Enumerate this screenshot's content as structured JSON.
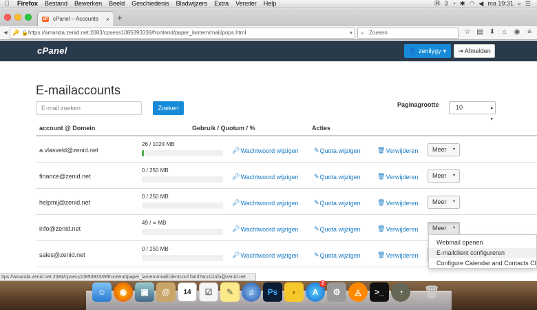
{
  "menubar": {
    "apple": "",
    "items": [
      "Firefox",
      "Bestand",
      "Bewerken",
      "Beeld",
      "Geschiedenis",
      "Bladwijzers",
      "Extra",
      "Venster",
      "Help"
    ],
    "status_num": "3",
    "clock": "ma 19:31"
  },
  "browser": {
    "tab_title": "cPanel – Accounts",
    "tab_favicon": "cP",
    "new_tab": "+",
    "url": "https://amanda.zenid.net:2083/cpsess1085393339/frontend/paper_lantern/mail/pops.html",
    "search_placeholder": "Zoeken",
    "status_url": "ttps://amanda.zenid.net:2083/cpsess1085393339/frontend/paper_lantern/mail/clientconf.html?acct=info@zenid.net"
  },
  "header": {
    "logo": "cPanel",
    "user": "zenilygy",
    "logout": "Afmelden"
  },
  "page": {
    "title": "E-mailaccounts",
    "search_placeholder": "E-mail zoeken",
    "search_button": "Zoeken",
    "page_size_label": "Paginagrootte",
    "page_size_value": "10"
  },
  "table": {
    "headers": {
      "account": "account @ Domein",
      "usage": "Gebruik / Quotum / %",
      "actions": "Acties"
    },
    "rows": [
      {
        "email": "a.vlasveld@zenid.net",
        "usage": "26 / 1024 MB",
        "percent": 2.5
      },
      {
        "email": "finance@zenid.net",
        "usage": "0 / 250 MB",
        "percent": 0
      },
      {
        "email": "helpmij@zenid.net",
        "usage": "0 / 250 MB",
        "percent": 0
      },
      {
        "email": "info@zenid.net",
        "usage": "49 / ∞ MB",
        "percent": 0
      },
      {
        "email": "sales@zenid.net",
        "usage": "0 / 250 MB",
        "percent": 0
      }
    ],
    "action_password": "Wachtwoord wijzigen",
    "action_quota": "Quota wijzigen",
    "action_delete": "Verwijderen",
    "action_more": "Meer"
  },
  "dropdown": {
    "items": [
      "Webmail openen",
      "E-mailclient configureren",
      "Configure Calendar and Contacts Client"
    ]
  },
  "colors": {
    "header_bg": "#293a4a",
    "primary": "#178bd8",
    "link": "#1a7bc4",
    "usage_fill": "#4caf50"
  },
  "dock": {
    "calendar_day": "14",
    "app_store_badge": "2",
    "icons": [
      "finder-icon",
      "firefox-icon",
      "preview-icon",
      "contacts-icon",
      "calendar-icon",
      "reminders-icon",
      "notes-icon",
      "itunes-icon",
      "photoshop-icon",
      "cyberduck-icon",
      "app-store-icon",
      "system-preferences-icon",
      "vlc-icon",
      "terminal-icon",
      "disk-utility-icon",
      "trash-icon"
    ]
  }
}
